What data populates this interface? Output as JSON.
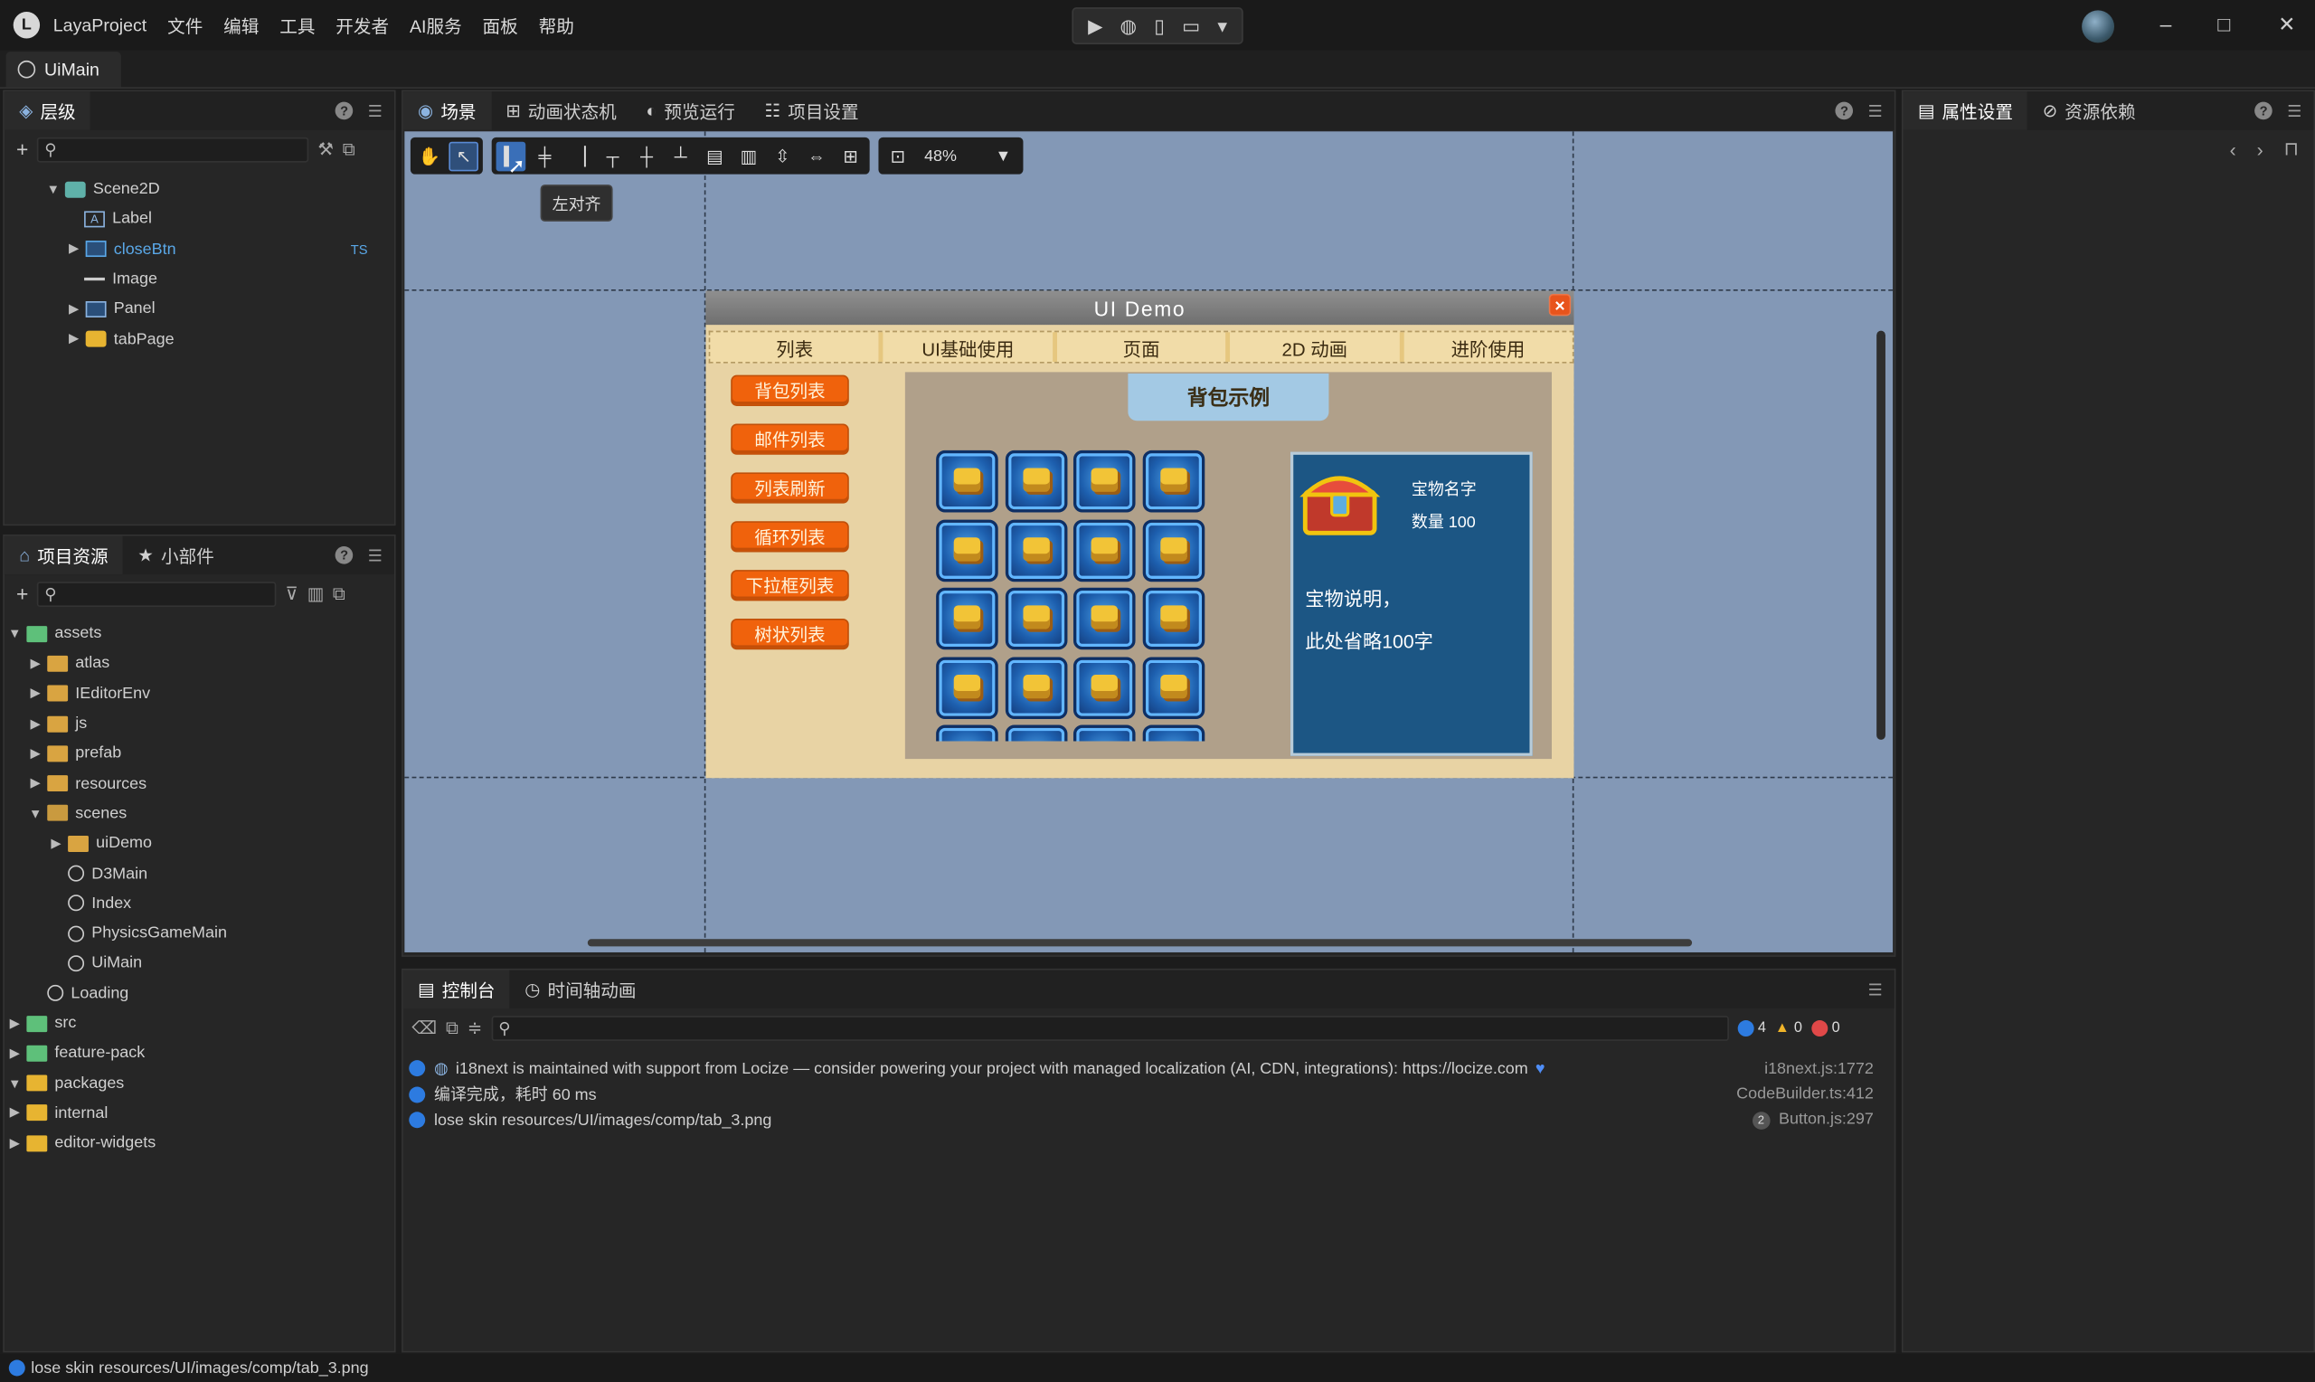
{
  "app": {
    "logo_text": "L",
    "project": "LayaProject"
  },
  "menu": [
    "文件",
    "编辑",
    "工具",
    "开发者",
    "AI服务",
    "面板",
    "帮助"
  ],
  "run_bar": [
    "play-icon",
    "globe-icon",
    "phone-icon",
    "monitor-icon",
    "dropdown-icon"
  ],
  "window_controls": {
    "minimize": "–",
    "maximize": "□",
    "close": "✕"
  },
  "doc_tab": "UiMain",
  "hierarchy": {
    "tab": "层级",
    "search_placeholder": "",
    "nodes": [
      {
        "label": "Scene2D",
        "expanded": true
      },
      {
        "label": "Label"
      },
      {
        "label": "closeBtn",
        "color": "#5aa8e8",
        "badge": "TS"
      },
      {
        "label": "Image"
      },
      {
        "label": "Panel"
      },
      {
        "label": "tabPage"
      }
    ]
  },
  "assets_panel": {
    "tabs": [
      "项目资源",
      "小部件"
    ],
    "tree": [
      "assets",
      "atlas",
      "IEditorEnv",
      "js",
      "prefab",
      "resources",
      "scenes",
      "uiDemo",
      "D3Main",
      "Index",
      "PhysicsGameMain",
      "UiMain",
      "Loading",
      "src",
      "feature-pack",
      "packages",
      "internal",
      "editor-widgets"
    ]
  },
  "center_tabs": [
    "场景",
    "动画状态机",
    "预览运行",
    "项目设置"
  ],
  "toolbar": {
    "zoom": "48%",
    "tooltip": "左对齐"
  },
  "ui_demo": {
    "title": "UI Demo",
    "close": "×",
    "tabs": [
      "列表",
      "UI基础使用",
      "页面",
      "2D 动画",
      "进阶使用"
    ],
    "side_buttons": [
      "背包列表",
      "邮件列表",
      "列表刷新",
      "循环列表",
      "下拉框列表",
      "树状列表"
    ],
    "panel_title": "背包示例",
    "item_name": "宝物名字",
    "item_count": "数量  100",
    "desc_line1": "宝物说明，",
    "desc_line2": "此处省略100字"
  },
  "right_tabs": [
    "属性设置",
    "资源依赖"
  ],
  "console": {
    "tabs": [
      "控制台",
      "时间轴动画"
    ],
    "counts": {
      "info": "4",
      "warn": "0",
      "error": "0"
    },
    "logs": [
      {
        "text": "i18next is maintained with support from Locize — consider powering your project with managed localization (AI, CDN, integrations): https://locize.com",
        "source": "i18next.js:1772",
        "globe": true,
        "heart": true
      },
      {
        "text": "编译完成，耗时 60 ms",
        "source": "CodeBuilder.ts:412"
      },
      {
        "text": "lose skin resources/UI/images/comp/tab_3.png",
        "source": "Button.js:297",
        "repeat": "2"
      }
    ]
  },
  "status": "lose skin resources/UI/images/comp/tab_3.png",
  "colors": {
    "accent": "#3a6fb8",
    "canvas": "#8398b6",
    "orange": "#f0620c",
    "demo_bg": "#e8d3a4"
  }
}
